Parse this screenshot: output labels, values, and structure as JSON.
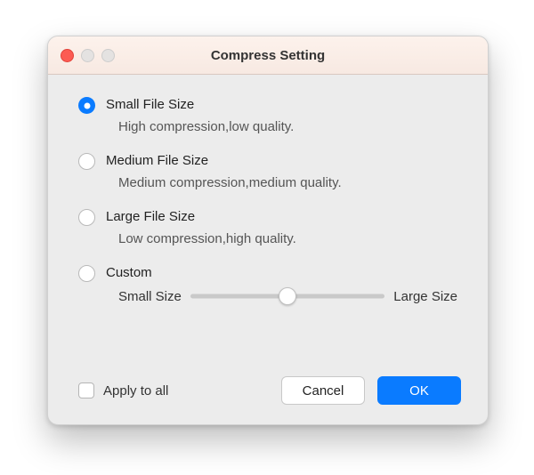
{
  "window": {
    "title": "Compress Setting"
  },
  "options": [
    {
      "title": "Small File Size",
      "desc": "High compression,low quality.",
      "selected": true
    },
    {
      "title": "Medium File Size",
      "desc": "Medium compression,medium quality.",
      "selected": false
    },
    {
      "title": "Large File Size",
      "desc": "Low compression,high quality.",
      "selected": false
    },
    {
      "title": "Custom",
      "selected": false
    }
  ],
  "slider": {
    "left_label": "Small Size",
    "right_label": "Large Size",
    "value": 0.5
  },
  "footer": {
    "apply_label": "Apply to all",
    "apply_checked": false,
    "cancel_label": "Cancel",
    "ok_label": "OK"
  }
}
